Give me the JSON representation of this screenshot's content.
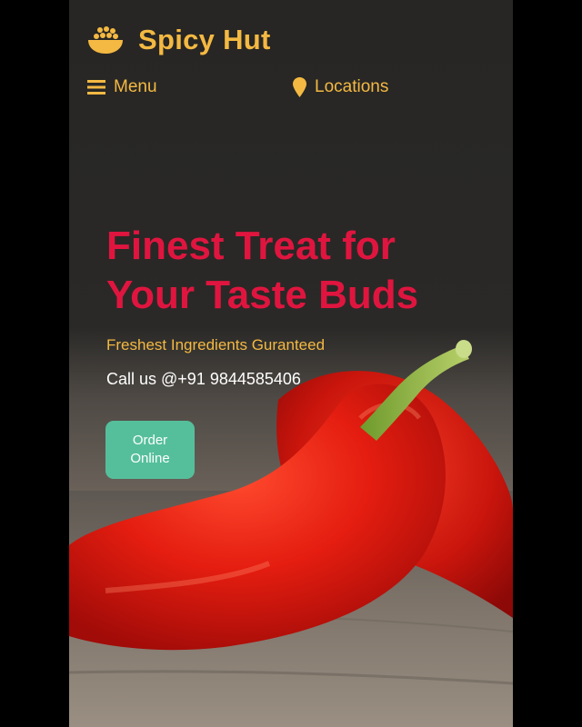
{
  "brand": {
    "name": "Spicy Hut",
    "logo_icon": "bowl-icon",
    "color": "#f4b942"
  },
  "nav": {
    "menu": {
      "label": "Menu",
      "icon": "hamburger-icon"
    },
    "locations": {
      "label": "Locations",
      "icon": "map-pin-icon"
    }
  },
  "hero": {
    "title": "Finest Treat for Your Taste Buds",
    "subtitle": "Freshest Ingredients Guranteed",
    "call": "Call us @+91 9844585406",
    "cta_label": "Order Online",
    "background": "red-chili-peppers-on-wooden-table-photo",
    "title_color": "#e0153f",
    "cta_color": "#55bf9b"
  }
}
